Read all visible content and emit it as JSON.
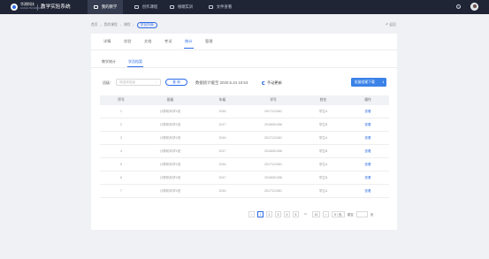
{
  "brand": {
    "logo_name": "华测科技",
    "logo_sub": "HUACE TECHNOLOGY",
    "title": "教学实验系统"
  },
  "nav": [
    {
      "label": "我的教学",
      "icon": "book-icon"
    },
    {
      "label": "创作课程",
      "icon": "edit-icon"
    },
    {
      "label": "线端实训",
      "icon": "monitor-icon"
    },
    {
      "label": "文件查看",
      "icon": "file-icon"
    }
  ],
  "header": {
    "help": "?"
  },
  "breadcrumb": {
    "items": [
      "首页",
      "我的课程",
      "课程",
      "学员列表"
    ],
    "separator": "/"
  },
  "back_label": "↶ 返回",
  "tabs": [
    {
      "label": "详情",
      "active": false
    },
    {
      "label": "实验",
      "active": false
    },
    {
      "label": "文档",
      "active": false
    },
    {
      "label": "考试",
      "active": false
    },
    {
      "label": "统计",
      "active": true
    },
    {
      "label": "管理",
      "active": false
    }
  ],
  "subtabs": [
    {
      "label": "教学统计",
      "active": false
    },
    {
      "label": "学员档案",
      "active": true
    }
  ],
  "filter": {
    "label": "班级：",
    "placeholder": "请选择班级",
    "chevron": "⌄",
    "query_button": "查 询"
  },
  "stat_time": "数据统计截至 2020.5.24  10:53",
  "refresh_label": "手动更新",
  "download_button": {
    "label": "批量档案下载",
    "icon": "download-icon",
    "glyph": "⭳"
  },
  "table": {
    "headers": [
      "序号",
      "班级",
      "年级",
      "学号",
      "姓名",
      "操作"
    ],
    "rows": [
      [
        "1",
        "计算机科学1班",
        "2016",
        "2017121081",
        "学生A",
        "查看"
      ],
      [
        "2",
        "计算机科学1班",
        "2017",
        "2018051456",
        "学生B",
        "查看"
      ],
      [
        "3",
        "计算机科学1班",
        "2016",
        "2017121081",
        "学生A",
        "查看"
      ],
      [
        "4",
        "计算机科学1班",
        "2017",
        "2018051456",
        "学生B",
        "查看"
      ],
      [
        "5",
        "计算机科学1班",
        "2016",
        "2017121081",
        "学生A",
        "查看"
      ],
      [
        "6",
        "计算机科学1班",
        "2017",
        "2018051456",
        "学生B",
        "查看"
      ],
      [
        "7",
        "计算机科学1班",
        "2016",
        "2017121081",
        "学生A",
        "查看"
      ]
    ]
  },
  "pagination": {
    "prev": "‹",
    "next": "›",
    "pages": [
      "1",
      "2",
      "3",
      "4",
      "5"
    ],
    "current": "1",
    "dots": "•••",
    "last": "10",
    "page_size": "5 / 页",
    "page_size_chevron": "⌄",
    "goto_label": "跳至",
    "page_unit": "页"
  },
  "colors": {
    "accent": "#2d6be8",
    "topbar": "#1f2535",
    "download_btn": "#3a82e8"
  }
}
